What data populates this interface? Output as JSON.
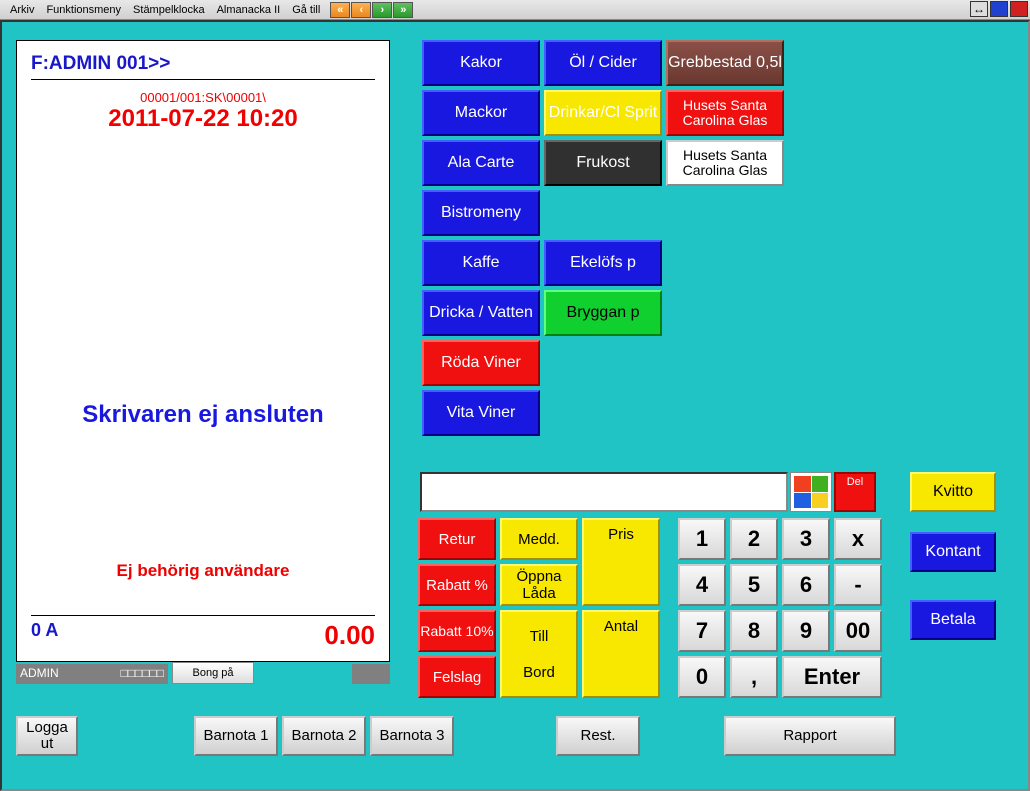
{
  "menu": [
    "Arkiv",
    "Funktionsmeny",
    "Stämpelklocka",
    "Almanacka II",
    "Gå till"
  ],
  "receipt": {
    "title": "F:ADMIN  001>>",
    "code": "00001/001:SK\\00001\\",
    "date": "2011-07-22 10:20",
    "msg1": "Skrivaren ej ansluten",
    "msg2": "Ej behörig användare",
    "footer_left": "0 A",
    "footer_right": "0.00"
  },
  "admin_bar": {
    "left": "ADMIN",
    "right": "□□□□□□"
  },
  "bong": "Bong på",
  "categories": {
    "r0c0": "Kakor",
    "r0c1": "Öl / Cider",
    "r0c2": "Grebbestad 0,5l",
    "r1c0": "Mackor",
    "r1c1": "Drinkar/Cl Sprit",
    "r1c2": "Husets Santa Carolina Glas",
    "r2c0": "Ala Carte",
    "r2c1": "Frukost",
    "r2c2": "Husets Santa Carolina Glas",
    "r3c0": "Bistromeny",
    "r4c0": "Kaffe",
    "r4c1": "Ekelöfs p",
    "r5c0": "Dricka / Vatten",
    "r5c1": "Bryggan p",
    "r6c0": "Röda Viner",
    "r7c0": "Vita Viner"
  },
  "del": "Del",
  "fn": {
    "retur": "Retur",
    "medd": "Medd.",
    "pris": "Pris",
    "rabatt_pct": "Rabatt %",
    "oppna": "Öppna Låda",
    "rabatt10": "Rabatt 10%",
    "till": "Till",
    "antal": "Antal",
    "felslag": "Felslag",
    "bord": "Bord"
  },
  "keys": {
    "k1": "1",
    "k2": "2",
    "k3": "3",
    "kx": "x",
    "k4": "4",
    "k5": "5",
    "k6": "6",
    "kdash": "-",
    "k7": "7",
    "k8": "8",
    "k9": "9",
    "k00": "00",
    "k0": "0",
    "kcomma": ",",
    "kenter": "Enter"
  },
  "pay": {
    "kvitto": "Kvitto",
    "kontant": "Kontant",
    "betala": "Betala"
  },
  "bottom": {
    "logga": "Logga ut",
    "b1": "Barnota 1",
    "b2": "Barnota 2",
    "b3": "Barnota 3",
    "rest": "Rest.",
    "rapport": "Rapport"
  }
}
